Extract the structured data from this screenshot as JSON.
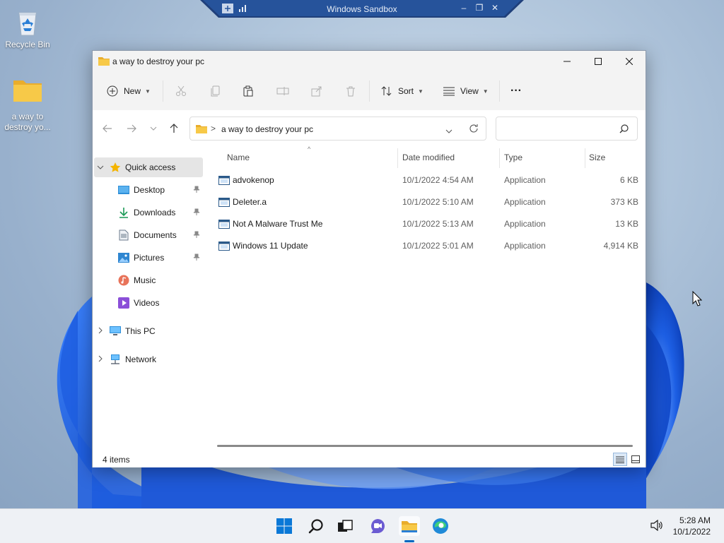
{
  "desktop": {
    "icons": [
      {
        "label": "Recycle Bin"
      },
      {
        "label_line1": "a way to",
        "label_line2": "destroy yo..."
      }
    ]
  },
  "sandbox": {
    "title": "Windows Sandbox"
  },
  "window": {
    "title": "a way to destroy your pc",
    "toolbar": {
      "new_label": "New",
      "sort_label": "Sort",
      "view_label": "View",
      "more_label": "···"
    },
    "address": {
      "crumb": "a way to destroy your pc",
      "separator": ">"
    },
    "search": {
      "placeholder": ""
    },
    "nav": {
      "quick_access": "Quick access",
      "items": [
        {
          "label": "Desktop",
          "pinned": true
        },
        {
          "label": "Downloads",
          "pinned": true
        },
        {
          "label": "Documents",
          "pinned": true
        },
        {
          "label": "Pictures",
          "pinned": true
        },
        {
          "label": "Music",
          "pinned": false
        },
        {
          "label": "Videos",
          "pinned": false
        }
      ],
      "this_pc": "This PC",
      "network": "Network"
    },
    "columns": {
      "name": "Name",
      "date": "Date modified",
      "type": "Type",
      "size": "Size"
    },
    "files": [
      {
        "name": "advokenop",
        "date": "10/1/2022 4:54 AM",
        "type": "Application",
        "size": "6 KB"
      },
      {
        "name": "Deleter.a",
        "date": "10/1/2022 5:10 AM",
        "type": "Application",
        "size": "373 KB"
      },
      {
        "name": "Not A Malware Trust Me",
        "date": "10/1/2022 5:13 AM",
        "type": "Application",
        "size": "13 KB"
      },
      {
        "name": "Windows 11 Update",
        "date": "10/1/2022 5:01 AM",
        "type": "Application",
        "size": "4,914 KB"
      }
    ],
    "status": {
      "count": "4 items"
    }
  },
  "taskbar": {
    "time": "5:28 AM",
    "date": "10/1/2022"
  },
  "colors": {
    "accent": "#0067c0",
    "folder": "#f5c242",
    "wallpaper_blue": "#1a56d6"
  }
}
